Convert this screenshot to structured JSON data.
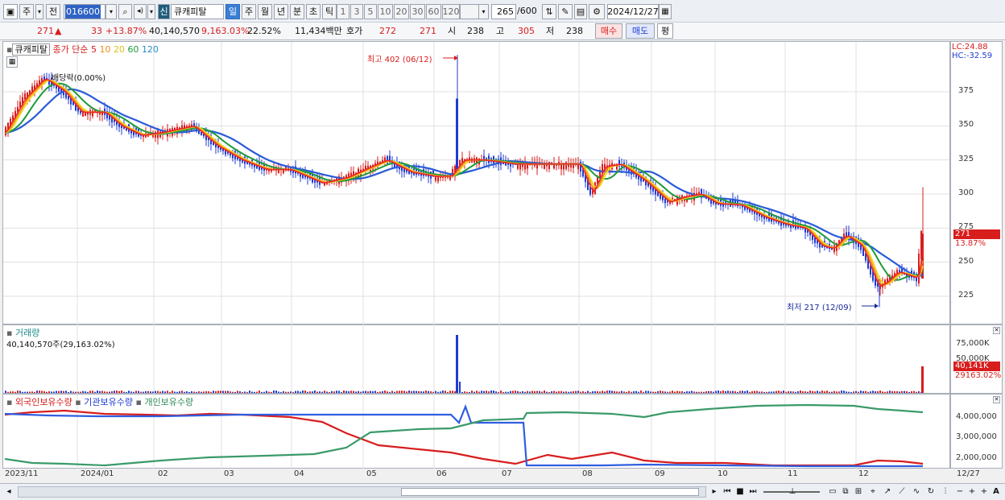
{
  "toolbar": {
    "period_label": "주",
    "prev_label": "전",
    "code": "016600",
    "speaker_label": "◂)",
    "new_label": "신",
    "stock_name": "큐캐피탈",
    "periods": [
      "일",
      "주",
      "월",
      "년",
      "분",
      "초",
      "틱"
    ],
    "numbers": [
      "1",
      "3",
      "5",
      "10",
      "20",
      "30",
      "60",
      "120"
    ],
    "count_value": "265",
    "count_total": "/600",
    "date": "2024/12/27"
  },
  "quote": {
    "price": "271",
    "arrow": "▲",
    "change": "33",
    "change_pct": "+13.87%",
    "volume": "40,140,570",
    "vol_ratio": "9,163.03%",
    "turnover": "22.52%",
    "amount": "11,434백만",
    "hoga_label": "호가",
    "hoga1": "272",
    "hoga2": "271",
    "open_label": "시",
    "open": "238",
    "high_label": "고",
    "high": "305",
    "low_label": "저",
    "low": "238",
    "buy_label": "매수",
    "sell_label": "매도",
    "eval_label": "평"
  },
  "price_pane": {
    "stock_label": "큐캐피탈",
    "legend_prefix": "종가 단순",
    "ma5": "5",
    "ma10": "10",
    "ma20": "20",
    "ma60": "60",
    "ma120": "120",
    "dividend": "배당락(0.00%)",
    "high_note": "최고 402 (06/12)",
    "low_note": "최저 217 (12/09)",
    "lc": "LC:24.88",
    "hc": "HC:-32.59",
    "ticks": [
      "375",
      "350",
      "325",
      "300",
      "275",
      "250",
      "225"
    ],
    "cur_price": "271",
    "cur_pct": "13.87%"
  },
  "volume_pane": {
    "title": "거래량",
    "value": "40,140,570주(29,163.02%)",
    "ticks": [
      "75,000K",
      "50,000K"
    ],
    "cur": "40,141K",
    "cur_pct": "29163.02%"
  },
  "holding_pane": {
    "foreign": "외국인보유수량",
    "institution": "기관보유수량",
    "individual": "개인보유수량",
    "ticks": [
      "4,000,000",
      "3,000,000",
      "2,000,000"
    ]
  },
  "xaxis": [
    "2023/11",
    "2024/01",
    "02",
    "03",
    "04",
    "05",
    "06",
    "07",
    "08",
    "09",
    "10",
    "11",
    "12",
    "12/27"
  ],
  "colors": {
    "up": "#d81d1d",
    "down": "#1f3bd1",
    "ma5": "#e8262b",
    "ma10": "#f08a1c",
    "ma20": "#f2d81a",
    "ma60": "#1e9a3c",
    "ma120": "#2a5bd8"
  }
}
